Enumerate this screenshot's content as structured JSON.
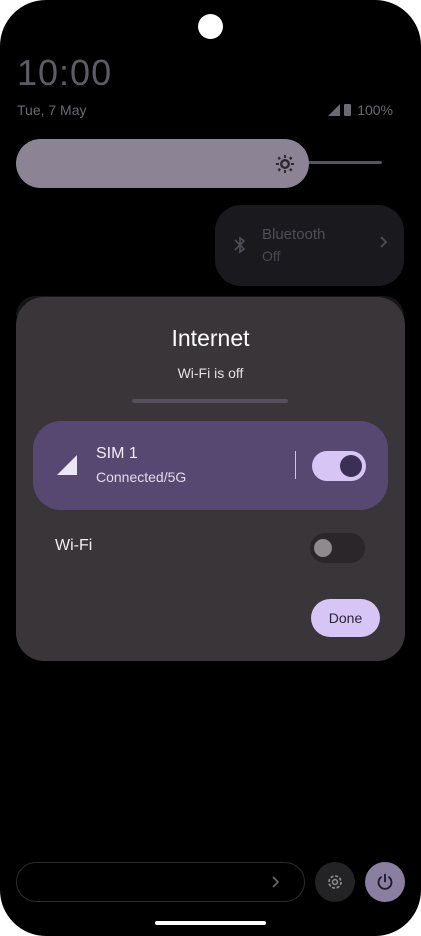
{
  "status_bar": {
    "time": "10:00",
    "date": "Tue, 7 May",
    "battery": "100%"
  },
  "quick_settings": {
    "brightness_level": 0.78,
    "bluetooth": {
      "title": "Bluetooth",
      "state": "Off"
    }
  },
  "internet_dialog": {
    "title": "Internet",
    "subtitle": "Wi-Fi is off",
    "sim": {
      "name": "SIM 1",
      "status": "Connected/5G",
      "enabled": true
    },
    "wifi": {
      "label": "Wi-Fi",
      "enabled": false
    },
    "done_label": "Done"
  },
  "colors": {
    "accent": "#d7c5f5",
    "sim_row": "#574872",
    "dialog_bg": "#3a3538"
  },
  "icons": [
    "bluetooth-icon",
    "brightness-icon",
    "cell-signal-icon",
    "battery-icon",
    "settings-icon",
    "power-icon",
    "chevron-right-icon"
  ]
}
